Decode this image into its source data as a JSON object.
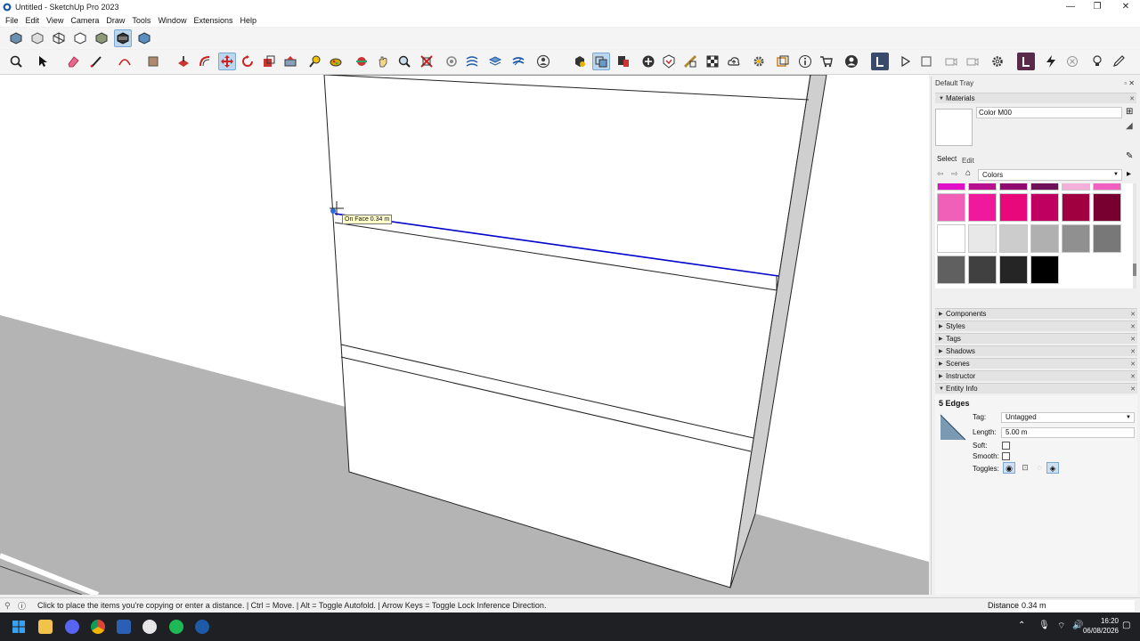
{
  "window": {
    "title": "Untitled - SketchUp Pro 2023",
    "minimize": "—",
    "maximize": "❐",
    "close": "✕"
  },
  "menu": [
    "File",
    "Edit",
    "View",
    "Camera",
    "Draw",
    "Tools",
    "Window",
    "Extensions",
    "Help"
  ],
  "viewport": {
    "tooltip": "On Face 0.34 m"
  },
  "tray": {
    "title": "Default Tray",
    "materials": {
      "header": "Materials",
      "material_name": "Color M00",
      "tab_select": "Select",
      "tab_edit": "Edit",
      "library": "Colors",
      "swatch_rows": [
        [
          "#e010c8",
          "#b81090",
          "#900870",
          "#701058",
          "#f4b0d8",
          "#f060c0"
        ],
        [
          "#f060b8",
          "#f0189c",
          "#e8087c",
          "#c00060",
          "#a00040",
          "#780030"
        ],
        [
          "#ffffff",
          "#e8e8e8",
          "#cccccc",
          "#b0b0b0",
          "#909090",
          "#787878"
        ],
        [
          "#606060",
          "#404040",
          "#252525",
          "#000000"
        ]
      ]
    },
    "panels": [
      "Components",
      "Styles",
      "Tags",
      "Shadows",
      "Scenes",
      "Instructor"
    ],
    "entity_info": {
      "header": "Entity Info",
      "selection": "5 Edges",
      "tag_label": "Tag:",
      "tag_value": "Untagged",
      "length_label": "Length:",
      "length_value": "5.00 m",
      "soft_label": "Soft:",
      "smooth_label": "Smooth:",
      "toggles_label": "Toggles:"
    }
  },
  "status": {
    "message": "Click to place the items you're copying or enter a distance. | Ctrl = Move. | Alt = Toggle Autofold. | Arrow Keys = Toggle Lock Inference Direction.",
    "distance_label": "Distance",
    "distance_value": "0.34 m"
  },
  "taskbar": {
    "time": "16:20",
    "date": "06/08/2026"
  },
  "colors": {
    "accent": "#3a6fd8",
    "selection_edge": "#0000cc",
    "ground": "#b4b4b4",
    "dark_tool": "#3a2a5a"
  }
}
